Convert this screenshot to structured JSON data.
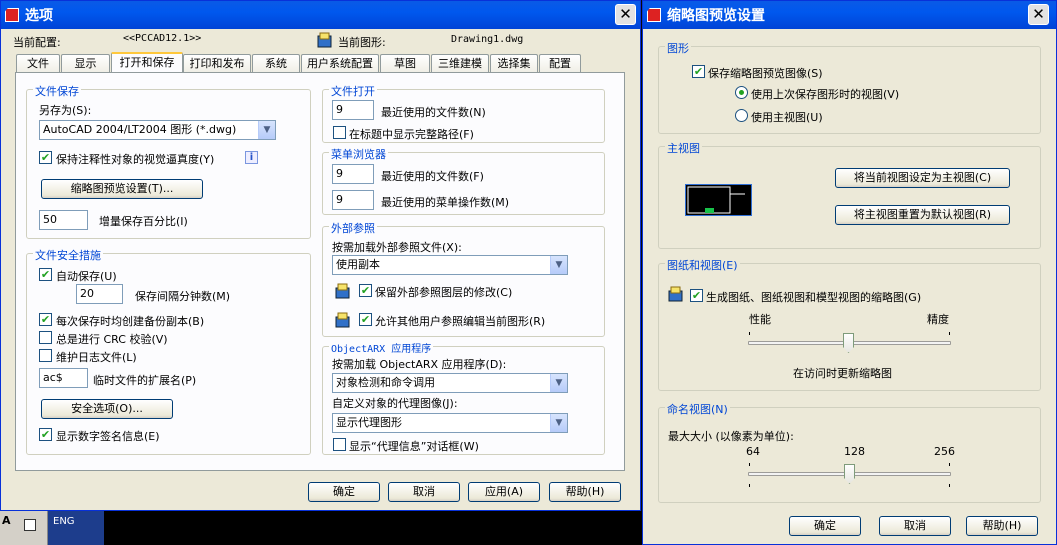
{
  "options_dialog": {
    "title": "选项",
    "close": "✕",
    "current_profile_label": "当前配置:",
    "current_profile_value": "<<PCCAD12.1>>",
    "current_drawing_label": "当前图形:",
    "current_drawing_value": "Drawing1.dwg",
    "tabs": [
      "文件",
      "显示",
      "打开和保存",
      "打印和发布",
      "系统",
      "用户系统配置",
      "草图",
      "三维建模",
      "选择集",
      "配置"
    ],
    "active_tab": "打开和保存",
    "file_save": {
      "title": "文件保存",
      "saveas_label": "另存为(S):",
      "saveas_value": "AutoCAD 2004/LT2004 图形 (*.dwg)",
      "annot_fidelity_label": "保持注释性对象的视觉逼真度(Y)",
      "annot_fidelity_checked": true,
      "info_icon": "i",
      "thumb_button": "缩略图预览设置(T)...",
      "incremental_value": "50",
      "incremental_label": "增量保存百分比(I)"
    },
    "file_safety": {
      "title": "文件安全措施",
      "autosave_label": "自动保存(U)",
      "autosave_checked": true,
      "interval_value": "20",
      "interval_label": "保存间隔分钟数(M)",
      "backup_label": "每次保存时均创建备份副本(B)",
      "backup_checked": true,
      "crc_label": "总是进行 CRC 校验(V)",
      "crc_checked": false,
      "log_label": "维护日志文件(L)",
      "log_checked": false,
      "temp_ext_value": "ac$",
      "temp_ext_label": "临时文件的扩展名(P)",
      "security_button": "安全选项(O)...",
      "digsig_label": "显示数字签名信息(E)",
      "digsig_checked": true
    },
    "file_open": {
      "title": "文件打开",
      "recent_value": "9",
      "recent_label": "最近使用的文件数(N)",
      "fullpath_label": "在标题中显示完整路径(F)",
      "fullpath_checked": false
    },
    "menu_browser": {
      "title": "菜单浏览器",
      "recent_files_value": "9",
      "recent_files_label": "最近使用的文件数(F)",
      "recent_actions_value": "9",
      "recent_actions_label": "最近使用的菜单操作数(M)"
    },
    "xref": {
      "title": "外部参照",
      "demand_label": "按需加载外部参照文件(X):",
      "demand_value": "使用副本",
      "retain_label": "保留外部参照图层的修改(C)",
      "retain_checked": true,
      "allow_edit_label": "允许其他用户参照编辑当前图形(R)",
      "allow_edit_checked": true
    },
    "objectarx": {
      "title": "ObjectARX 应用程序",
      "demand_label": "按需加载 ObjectARX 应用程序(D):",
      "demand_value": "对象检测和命令调用",
      "proxy_label": "自定义对象的代理图像(J):",
      "proxy_value": "显示代理图形",
      "proxy_info_label": "显示“代理信息”对话框(W)",
      "proxy_info_checked": false
    },
    "buttons": {
      "ok": "确定",
      "cancel": "取消",
      "apply": "应用(A)",
      "help": "帮助(H)"
    }
  },
  "thumb_dialog": {
    "title": "缩略图预览设置",
    "close": "✕",
    "drawing": {
      "title": "图形",
      "save_thumb_label": "保存缩略图预览图像(S)",
      "save_thumb_checked": true,
      "radio_last_label": "使用上次保存图形时的视图(V)",
      "radio_last_selected": true,
      "radio_home_label": "使用主视图(U)",
      "radio_home_selected": false
    },
    "home_view": {
      "title": "主视图",
      "set_button": "将当前视图设定为主视图(C)",
      "reset_button": "将主视图重置为默认视图(R)"
    },
    "sheets": {
      "title": "图纸和视图(E)",
      "generate_label": "生成图纸、图纸视图和模型视图的缩略图(G)",
      "generate_checked": true,
      "perf_label": "性能",
      "accuracy_label": "精度",
      "slider_position": 0.5,
      "update_label": "在访问时更新缩略图"
    },
    "named_views": {
      "title": "命名视图(N)",
      "max_size_label": "最大大小 (以像素为单位):",
      "tick_min": "64",
      "tick_mid": "128",
      "tick_max": "256",
      "slider_value": 128
    },
    "buttons": {
      "ok": "确定",
      "cancel": "取消",
      "help": "帮助(H)"
    }
  },
  "taskbar": {
    "lang": "ENG"
  },
  "colors": {
    "title_blue": "#0058ee",
    "group_title": "#0046d5",
    "check_green": "#21a121"
  }
}
